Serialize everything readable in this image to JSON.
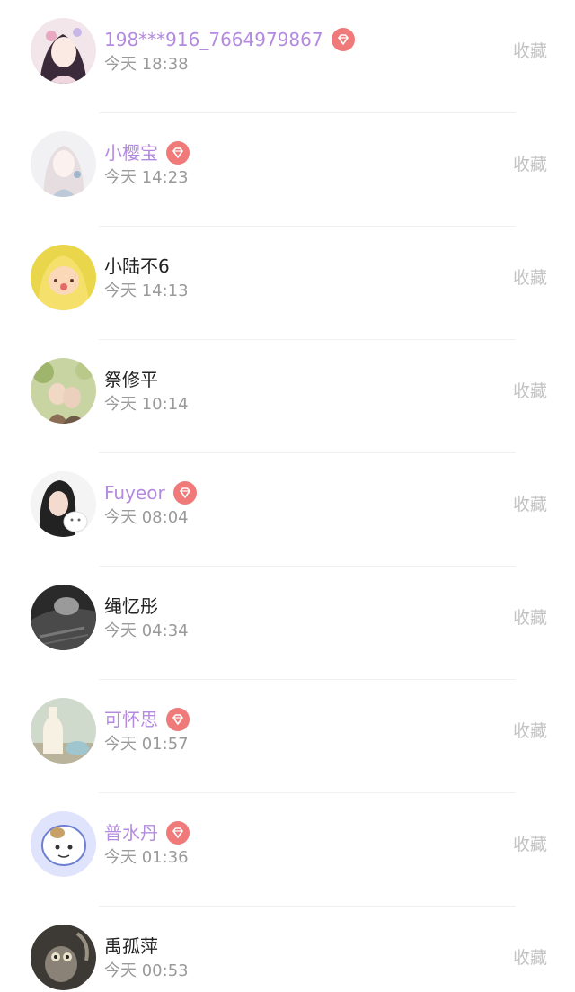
{
  "vip_color": "#b48ae0",
  "badge_color": "#f07a7a",
  "collect_color": "#c3c3c3",
  "items": [
    {
      "name": "198***916_7664979867",
      "vip": true,
      "time": "今天 18:38",
      "action": "收藏",
      "avatar_icon": "anime-girl-avatar"
    },
    {
      "name": "小樱宝",
      "vip": true,
      "time": "今天 14:23",
      "action": "收藏",
      "avatar_icon": "pale-girl-avatar"
    },
    {
      "name": "小陆不6",
      "vip": false,
      "time": "今天 14:13",
      "action": "收藏",
      "avatar_icon": "yellow-cartoon-avatar"
    },
    {
      "name": "祭修平",
      "vip": false,
      "time": "今天 10:14",
      "action": "收藏",
      "avatar_icon": "couple-illustration-avatar"
    },
    {
      "name": "Fuyeor",
      "vip": true,
      "time": "今天 08:04",
      "action": "收藏",
      "avatar_icon": "girl-with-cat-avatar"
    },
    {
      "name": "绳忆彤",
      "vip": false,
      "time": "今天 04:34",
      "action": "收藏",
      "avatar_icon": "monochrome-photo-avatar"
    },
    {
      "name": "可怀思",
      "vip": true,
      "time": "今天 01:57",
      "action": "收藏",
      "avatar_icon": "bottle-still-life-avatar"
    },
    {
      "name": "普水丹",
      "vip": true,
      "time": "今天 01:36",
      "action": "收藏",
      "avatar_icon": "cartoon-kid-avatar"
    },
    {
      "name": "禹孤萍",
      "vip": false,
      "time": "今天 00:53",
      "action": "收藏",
      "avatar_icon": "owl-photo-avatar"
    }
  ]
}
